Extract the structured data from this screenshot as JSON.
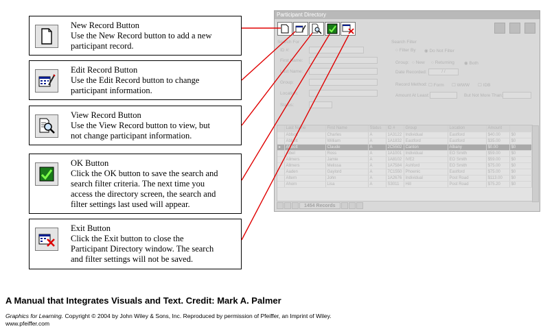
{
  "callouts": [
    {
      "icon": "new-record-icon",
      "title": "New Record Button",
      "lines": [
        "Use the New Record button to add a new",
        "participant record."
      ]
    },
    {
      "icon": "edit-record-icon",
      "title": "Edit Record Button",
      "lines": [
        "Use the Edit Record button to change",
        "participant information."
      ]
    },
    {
      "icon": "view-record-icon",
      "title": "View Record Button",
      "lines": [
        "Use the View Record button to view, but",
        "not change participant information."
      ]
    },
    {
      "icon": "ok-icon",
      "title": "OK Button",
      "lines": [
        "Click the OK button to save the search and",
        "search filter criteria. The next time you",
        "access the directory screen, the search and",
        "filter settings last used will appear."
      ]
    },
    {
      "icon": "exit-icon",
      "title": "Exit Button",
      "lines": [
        "Click the Exit button to close the",
        "Participant Directory window. The search",
        "and filter settings will not be saved."
      ]
    }
  ],
  "window": {
    "title": "Participant Directory",
    "search_for": "Search For",
    "fields": [
      "ID #:",
      "First Name:",
      "Last Name:",
      "Group:",
      "Location:",
      "Status:"
    ],
    "search_filter": "Search Filter",
    "filter_by": "Filter By",
    "do_not_filter": "Do Not Filter",
    "group_label": "Group:",
    "group_options": [
      "New",
      "Returning",
      "Both"
    ],
    "date_recorded": "Date Recorded:",
    "date_value": "/ /",
    "record_method": "Record Method:",
    "methods": [
      "Form",
      "WWW",
      "IDB"
    ],
    "amount_least": "Amount At Least:",
    "not_more": "But Not More Than:",
    "columns": [
      "Last Name",
      "First Name",
      "Status",
      "ID #",
      "Group",
      "Location",
      "Amount"
    ],
    "rows": [
      [
        "Abbott",
        "Charles",
        "A",
        "1A3122",
        "Individual",
        "Eastford",
        "$40.00",
        "$0"
      ],
      [
        "Abbott",
        "William",
        "A",
        "1A1832",
        "Eastford",
        "Eastford",
        "$35.00",
        "$0"
      ],
      [
        "Abbott",
        "Claude",
        "A",
        "2C5502",
        "Canton",
        "Albany",
        "$0.00",
        "$0"
      ],
      [
        "Albel",
        "Ross",
        "A",
        "1A1001",
        "Individual",
        "EO Smith",
        "$59.00",
        "$0"
      ],
      [
        "Allmers",
        "Jamie",
        "A",
        "1A8102",
        "IVE2",
        "EO Smith",
        "$59.00",
        "$0"
      ],
      [
        "Allmers",
        "Melissa",
        "A",
        "1A7584",
        "Ashford",
        "EO Smith",
        "$75.00",
        "$0"
      ],
      [
        "Aaden",
        "Gaylord",
        "A",
        "7C1550",
        "Phoenic",
        "Eastford",
        "$75.00",
        "$0"
      ],
      [
        "Altern",
        "John",
        "A",
        "1A2676",
        "Individual",
        "Post Road",
        "$113.00",
        "$0"
      ],
      [
        "Ahorn",
        "Lisa",
        "A",
        "S3011",
        "Hill",
        "Post Road",
        "$75.20",
        "$0"
      ]
    ],
    "record_count": "1454 Records"
  },
  "caption": {
    "title": "A Manual that Integrates Visuals and Text.  Credit:  Mark A. Palmer",
    "credit_italic": "Graphics for Learning.",
    "credit_rest": " Copyright © 2004 by John Wiley & Sons, Inc. Reproduced by permission of Pfeiffer, an Imprint of Wiley.",
    "url": "www.pfeiffer.com"
  },
  "colors": {
    "accent_line": "#e00000",
    "window_bg": "#d9d9d9"
  }
}
